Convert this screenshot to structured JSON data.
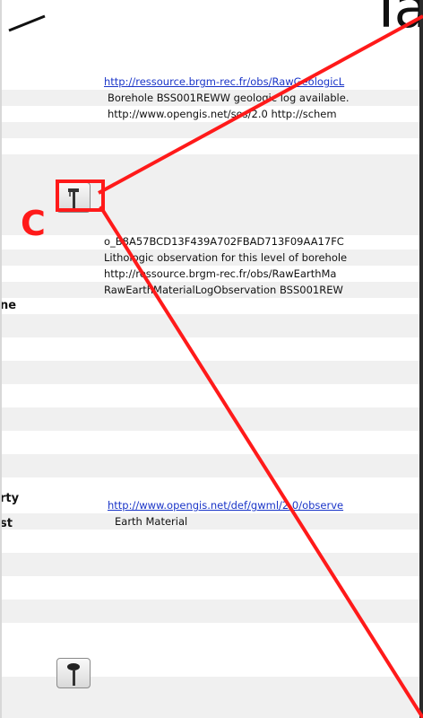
{
  "header": {
    "right_fragment": "Ta"
  },
  "rows": [
    {
      "label": "",
      "value": "http://ressource.brgm-rec.fr/obs/RawGeologicL",
      "link": true
    },
    {
      "label": "",
      "value": "Borehole BSS001REWW geologic log available.",
      "link": false
    },
    {
      "label": "",
      "value": "http://www.opengis.net/sos/2.0 http://schem",
      "link": false
    },
    {
      "label": "",
      "value": "o_B8A57BCD13F439A702FBAD713F09AA17FC",
      "link": false
    },
    {
      "label": "",
      "value": "Lithologic observation for this level of borehole",
      "link": false
    },
    {
      "label": "",
      "value": "http://ressource.brgm-rec.fr/obs/RawEarthMa",
      "link": false
    },
    {
      "label": "",
      "value": "RawEarthMaterialLogObservation BSS001REW",
      "link": false
    },
    {
      "label": "ne",
      "value": "",
      "link": false
    },
    {
      "label": "rty",
      "value": "http://www.opengis.net/def/gwml/2.0/observe",
      "link": true
    },
    {
      "label": "",
      "value": "Earth Material",
      "link": false
    },
    {
      "label": "st",
      "value": "",
      "link": false
    }
  ],
  "annotation": {
    "letter": "C",
    "color": "#ff1a1a"
  },
  "icons": [
    "pin-icon",
    "pin-icon"
  ]
}
